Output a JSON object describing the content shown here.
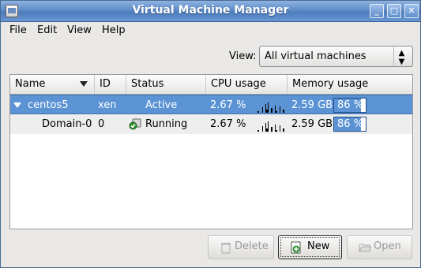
{
  "window": {
    "title": "Virtual Machine Manager"
  },
  "menu": {
    "file": "File",
    "edit": "Edit",
    "view": "View",
    "help": "Help"
  },
  "view_filter": {
    "label": "View:",
    "value": "All virtual machines"
  },
  "columns": {
    "name": "Name",
    "id": "ID",
    "status": "Status",
    "cpu": "CPU usage",
    "memory": "Memory usage"
  },
  "rows": [
    {
      "name": "centos5",
      "id": "xen",
      "status": "Active",
      "cpu": "2.67 %",
      "memory": "2.59 GB",
      "mem_pct_label": "86 %",
      "mem_pct": 0.86,
      "selected": true
    },
    {
      "name": "Domain-0",
      "id": "0",
      "status": "Running",
      "cpu": "2.67 %",
      "memory": "2.59 GB",
      "mem_pct_label": "86 %",
      "mem_pct": 0.86,
      "selected": false
    }
  ],
  "buttons": {
    "delete": "Delete",
    "new": "New",
    "open": "Open"
  },
  "colors": {
    "selection": "#5b93d4",
    "titlebar": "#5f8cc8"
  }
}
